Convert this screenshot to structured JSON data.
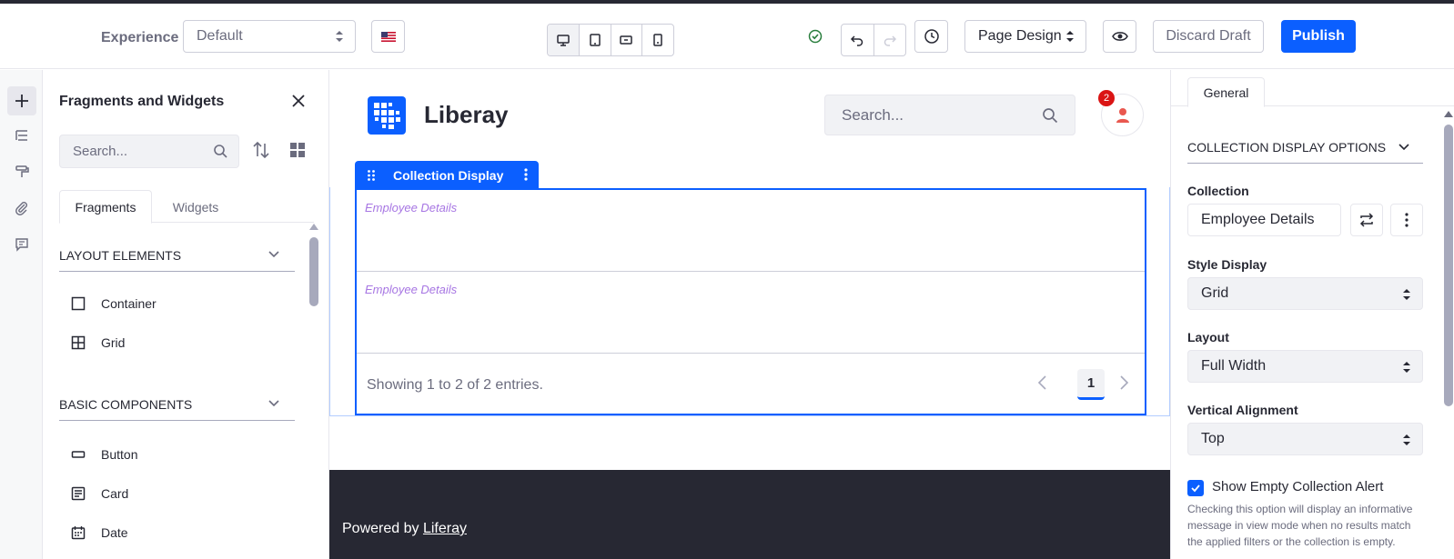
{
  "toolbar": {
    "experience_label": "Experience",
    "experience_value": "Default",
    "page_design_label": "Page Design",
    "discard_label": "Discard Draft",
    "publish_label": "Publish"
  },
  "sidebar": {
    "title": "Fragments and Widgets",
    "search_placeholder": "Search...",
    "tabs": [
      "Fragments",
      "Widgets"
    ],
    "sections": [
      {
        "title": "LAYOUT ELEMENTS",
        "items": [
          "Container",
          "Grid"
        ]
      },
      {
        "title": "BASIC COMPONENTS",
        "items": [
          "Button",
          "Card",
          "Date"
        ]
      }
    ]
  },
  "canvas": {
    "brand": "Liberay",
    "search_placeholder": "Search...",
    "notification_count": "2",
    "collection_label": "Collection Display",
    "items": [
      "Employee Details",
      "Employee Details"
    ],
    "showing_text": "Showing 1 to 2 of 2 entries.",
    "current_page": "1",
    "footer_prefix": "Powered by",
    "footer_link": "Liferay"
  },
  "rpanel": {
    "tab": "General",
    "section": "COLLECTION DISPLAY OPTIONS",
    "collection_label": "Collection",
    "collection_value": "Employee Details",
    "style_label": "Style Display",
    "style_value": "Grid",
    "layout_label": "Layout",
    "layout_value": "Full Width",
    "valign_label": "Vertical Alignment",
    "valign_value": "Top",
    "empty_alert_label": "Show Empty Collection Alert",
    "empty_alert_help": "Checking this option will display an informative message in view mode when no results match the applied filters or the collection is empty."
  },
  "colors": {
    "primary": "#0b5fff",
    "dark": "#272833",
    "muted": "#6b6c7e",
    "item_text": "#a776e3"
  }
}
